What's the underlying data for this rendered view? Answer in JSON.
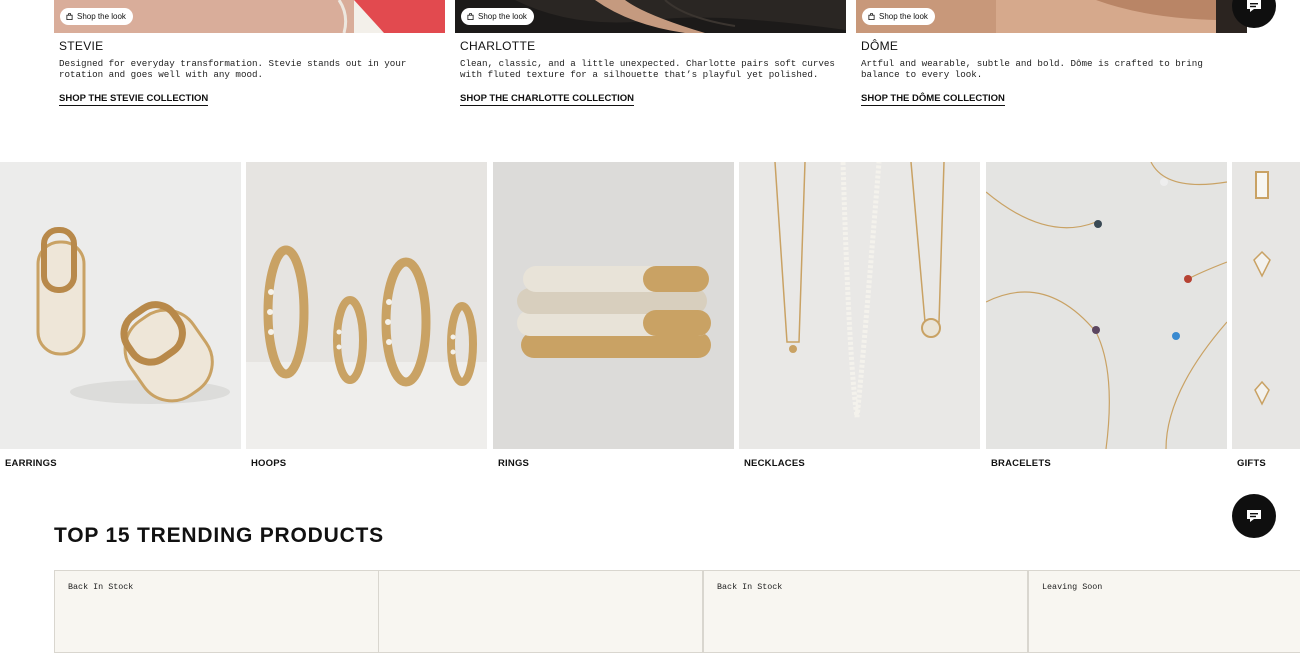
{
  "collections": [
    {
      "shop_look": "Shop the look",
      "title": "STEVIE",
      "description": "Designed for everyday transformation. Stevie stands out in your rotation and goes well with any mood.",
      "link": "SHOP THE STEVIE COLLECTION"
    },
    {
      "shop_look": "Shop the look",
      "title": "CHARLOTTE",
      "description": "Clean, classic, and a little unexpected. Charlotte pairs soft curves with fluted texture for a silhouette that’s playful yet polished.",
      "link": "SHOP THE CHARLOTTE COLLECTION"
    },
    {
      "shop_look": "Shop the look",
      "title": "DÔME",
      "description": "Artful and wearable, subtle and bold. Dôme is crafted to bring balance to every look.",
      "link": "SHOP THE DÔME COLLECTION"
    }
  ],
  "categories": [
    {
      "label": "EARRINGS"
    },
    {
      "label": "HOOPS"
    },
    {
      "label": "RINGS"
    },
    {
      "label": "NECKLACES"
    },
    {
      "label": "BRACELETS"
    },
    {
      "label": "GIFTS"
    }
  ],
  "trending": {
    "title": "TOP 15 TRENDING PRODUCTS",
    "products": [
      {
        "badge": "Back In Stock"
      },
      {
        "badge": ""
      },
      {
        "badge": "Back In Stock"
      },
      {
        "badge": "Leaving Soon"
      }
    ]
  },
  "colors": {
    "accent": "#0f0f0f",
    "gold": "#c9a264",
    "card_bg": "#f8f6f1"
  },
  "icons": {
    "chat": "chat-bubble-icon",
    "bag": "shopping-bag-icon"
  }
}
